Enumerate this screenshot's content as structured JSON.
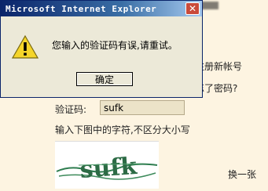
{
  "page": {
    "register_link": "注册新帐号",
    "forgot_link": "忘了密码?",
    "captcha_label": "验证码:",
    "captcha_value": "sufk",
    "captcha_hint": "输入下图中的字符,不区分大小写",
    "captcha_image_text": "sufk",
    "refresh_label": "换一张"
  },
  "dialog": {
    "title": "Microsoft Internet Explorer",
    "close_glyph": "✕",
    "message": "您输入的验证码有误,请重试。",
    "ok_label": "确定",
    "icon": "warning-icon"
  },
  "colors": {
    "titlebar_start": "#0a246a",
    "titlebar_end": "#a6caf0",
    "dialog_bg": "#ece9d8",
    "page_bg": "#fdf4e1",
    "warning_yellow": "#f5d52a"
  }
}
